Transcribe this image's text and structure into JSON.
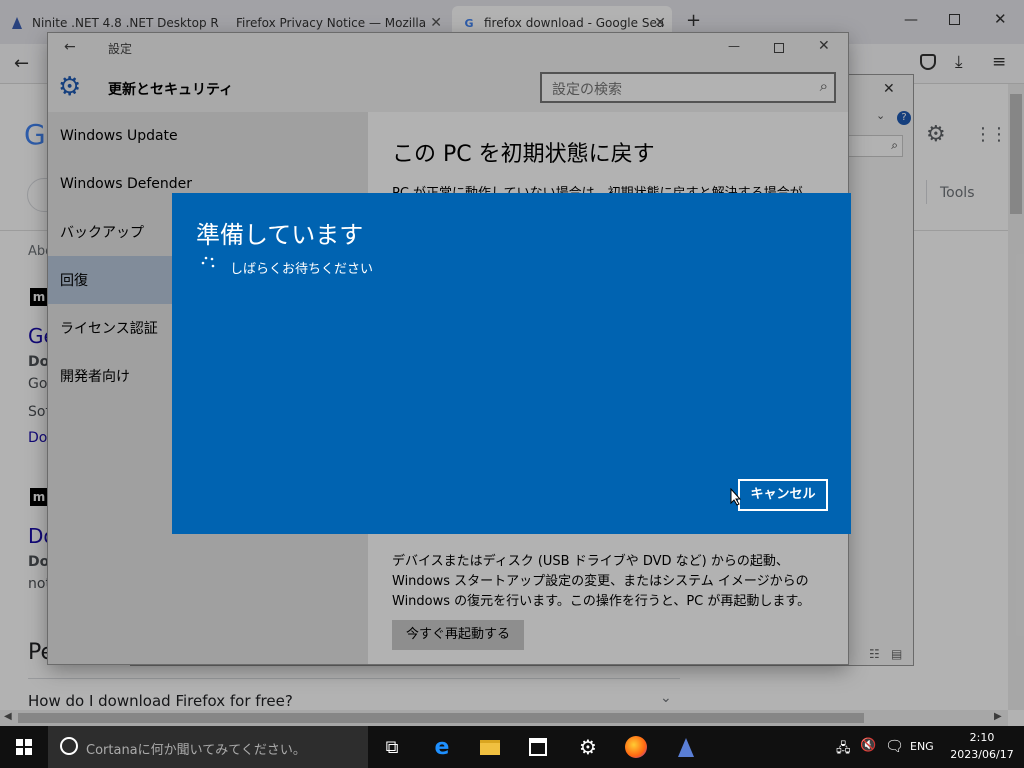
{
  "browser": {
    "tabs": [
      {
        "title": "Ninite .NET 4.8 .NET Desktop R"
      },
      {
        "title": "Firefox Privacy Notice — Mozilla"
      },
      {
        "title": "firefox download - Google Sea"
      }
    ],
    "new_tab": "+",
    "page": {
      "logo_letter": "G",
      "tools": "Tools",
      "about": "Abo",
      "results": [
        {
          "badge": "m",
          "title": "Ge",
          "bold": "Do",
          "line1": "Go",
          "line2": "Sof",
          "link": "Dov"
        },
        {
          "badge": "m",
          "title": "Do",
          "bold": "Do",
          "line1": "not"
        }
      ],
      "people_ask": "Pe",
      "question": "How do I download Firefox for free?"
    }
  },
  "back_window": {
    "help": "?"
  },
  "settings": {
    "title": "設定",
    "header": "更新とセキュリティ",
    "search_placeholder": "設定の検索",
    "nav": [
      "Windows Update",
      "Windows Defender",
      "バックアップ",
      "回復",
      "ライセンス認証",
      "開発者向け"
    ],
    "selected_index": 3,
    "content_title": "この PC を初期状態に戻す",
    "content_partial": "PC が正常に動作していない場合は、初期状態に戻すと解決する場合が",
    "advanced_text": "デバイスまたはディスク (USB ドライブや DVD など) からの起動、Windows スタートアップ設定の変更、またはシステム イメージからの Windows の復元を行います。この操作を行うと、PC が再起動します。",
    "restart_button": "今すぐ再起動する"
  },
  "dialog": {
    "title": "準備しています",
    "message": "しばらくお待ちください",
    "cancel": "キャンセル",
    "bg_color": "#0063b1"
  },
  "taskbar": {
    "search_placeholder": "Cortanaに何か聞いてみてください。",
    "lang": "ENG",
    "time": "2:10",
    "date": "2023/06/17"
  }
}
